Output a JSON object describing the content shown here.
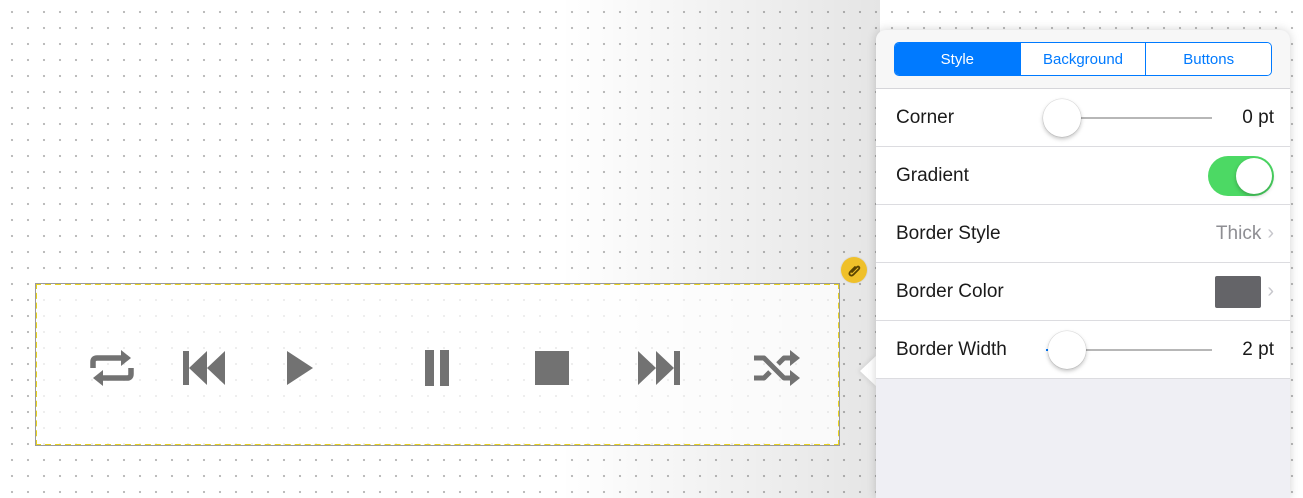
{
  "tabs": [
    {
      "label": "Style",
      "active": true
    },
    {
      "label": "Background",
      "active": false
    },
    {
      "label": "Buttons",
      "active": false
    }
  ],
  "settings": {
    "corner": {
      "label": "Corner",
      "value": "0 pt",
      "level": 0.0
    },
    "gradient": {
      "label": "Gradient",
      "on": true
    },
    "border_style": {
      "label": "Border Style",
      "value": "Thick"
    },
    "border_color": {
      "label": "Border Color",
      "color": "#646468"
    },
    "border_width": {
      "label": "Border Width",
      "value": "2 pt",
      "level": 0.02
    }
  },
  "controls": [
    "repeat-icon",
    "skip-back-icon",
    "play-icon",
    "pause-icon",
    "stop-icon",
    "skip-forward-icon",
    "shuffle-icon"
  ],
  "colors": {
    "accent": "#007aff",
    "toggle_on": "#4cd964",
    "selection_dash": "#e7d21d",
    "icon_gray": "#727272",
    "link_badge": "#efc02a"
  }
}
